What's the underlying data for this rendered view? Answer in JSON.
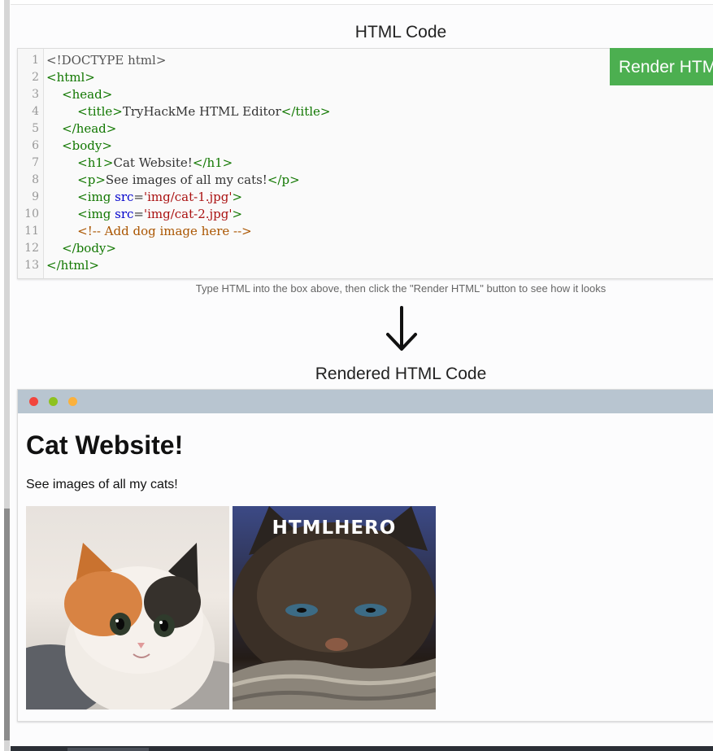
{
  "editor": {
    "title": "HTML Code",
    "render_button_label": "Render HTML",
    "lines": [
      {
        "n": "1",
        "seg": [
          {
            "c": "meta",
            "t": "<!DOCTYPE html>"
          }
        ]
      },
      {
        "n": "2",
        "seg": [
          {
            "c": "tag",
            "t": "<html>"
          }
        ]
      },
      {
        "n": "3",
        "seg": [
          {
            "c": "plain",
            "t": "    "
          },
          {
            "c": "tag",
            "t": "<head>"
          }
        ]
      },
      {
        "n": "4",
        "seg": [
          {
            "c": "plain",
            "t": "        "
          },
          {
            "c": "tag",
            "t": "<title>"
          },
          {
            "c": "plain",
            "t": "TryHackMe HTML Editor"
          },
          {
            "c": "tag",
            "t": "</title>"
          }
        ]
      },
      {
        "n": "5",
        "seg": [
          {
            "c": "plain",
            "t": "    "
          },
          {
            "c": "tag",
            "t": "</head>"
          }
        ]
      },
      {
        "n": "6",
        "seg": [
          {
            "c": "plain",
            "t": "    "
          },
          {
            "c": "tag",
            "t": "<body>"
          }
        ]
      },
      {
        "n": "7",
        "seg": [
          {
            "c": "plain",
            "t": "        "
          },
          {
            "c": "tag",
            "t": "<h1>"
          },
          {
            "c": "plain",
            "t": "Cat Website!"
          },
          {
            "c": "tag",
            "t": "</h1>"
          }
        ]
      },
      {
        "n": "8",
        "seg": [
          {
            "c": "plain",
            "t": "        "
          },
          {
            "c": "tag",
            "t": "<p>"
          },
          {
            "c": "plain",
            "t": "See images of all my cats!"
          },
          {
            "c": "tag",
            "t": "</p>"
          }
        ]
      },
      {
        "n": "9",
        "seg": [
          {
            "c": "plain",
            "t": "        "
          },
          {
            "c": "tag",
            "t": "<img "
          },
          {
            "c": "attr",
            "t": "src"
          },
          {
            "c": "plain",
            "t": "="
          },
          {
            "c": "str",
            "t": "'img/cat-1.jpg'"
          },
          {
            "c": "tag",
            "t": ">"
          }
        ]
      },
      {
        "n": "10",
        "seg": [
          {
            "c": "plain",
            "t": "        "
          },
          {
            "c": "tag",
            "t": "<img "
          },
          {
            "c": "attr",
            "t": "src"
          },
          {
            "c": "plain",
            "t": "="
          },
          {
            "c": "str",
            "t": "'img/cat-2.jpg'"
          },
          {
            "c": "tag",
            "t": ">"
          }
        ]
      },
      {
        "n": "11",
        "seg": [
          {
            "c": "plain",
            "t": "        "
          },
          {
            "c": "com",
            "t": "<!-- Add dog image here -->"
          }
        ]
      },
      {
        "n": "12",
        "seg": [
          {
            "c": "plain",
            "t": "    "
          },
          {
            "c": "tag",
            "t": "</body>"
          }
        ]
      },
      {
        "n": "13",
        "seg": [
          {
            "c": "tag",
            "t": "</html>"
          }
        ]
      }
    ]
  },
  "hint": "Type HTML into the box above, then click the \"Render HTML\" button to see how it looks",
  "rendered": {
    "title": "Rendered HTML Code",
    "h1": "Cat Website!",
    "paragraph": "See images of all my cats!",
    "image2_caption": "HTMLHERO"
  },
  "colors": {
    "render_button": "#4caf50",
    "browser_bar": "#b8c5d0",
    "dot_red": "#f2453d",
    "dot_green": "#8dc21f",
    "dot_yellow": "#fbb13c"
  },
  "icons": {
    "arrow": "arrow-down-icon"
  }
}
